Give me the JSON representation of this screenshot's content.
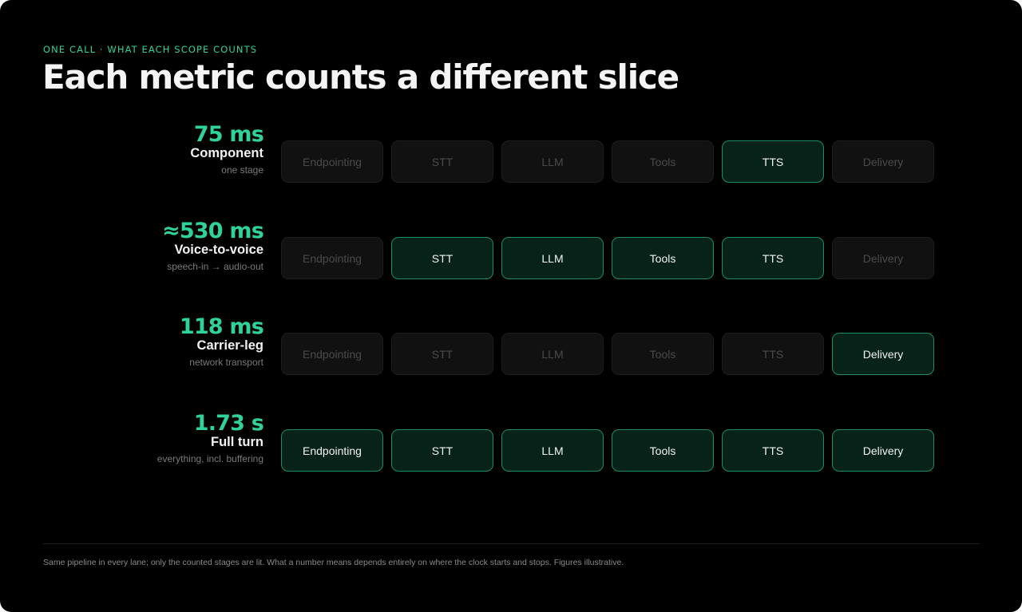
{
  "header": {
    "eyebrow": "ONE CALL · WHAT EACH SCOPE COUNTS",
    "title": "Each metric counts a different slice"
  },
  "stages": [
    "Endpointing",
    "STT",
    "LLM",
    "Tools",
    "TTS",
    "Delivery"
  ],
  "lanes": [
    {
      "value": "75 ms",
      "name": "Component",
      "description": "one stage",
      "lit": [
        false,
        false,
        false,
        false,
        true,
        false
      ]
    },
    {
      "value": "≈530 ms",
      "name": "Voice-to-voice",
      "description": "speech-in → audio-out",
      "lit": [
        false,
        true,
        true,
        true,
        true,
        false
      ]
    },
    {
      "value": "118 ms",
      "name": "Carrier-leg",
      "description": "network transport",
      "lit": [
        false,
        false,
        false,
        false,
        false,
        true
      ]
    },
    {
      "value": "1.73 s",
      "name": "Full turn",
      "description": "everything, incl. buffering",
      "lit": [
        true,
        true,
        true,
        true,
        true,
        true
      ]
    }
  ],
  "colors": {
    "accent": "#2fd39a",
    "lit_fill": "#062219",
    "lit_border": "#1f8d63",
    "unlit_fill": "#111111"
  },
  "footer": {
    "note": "Same pipeline in every lane; only the counted stages are lit. What a number means depends entirely on where the clock starts and stops. Figures illustrative."
  }
}
